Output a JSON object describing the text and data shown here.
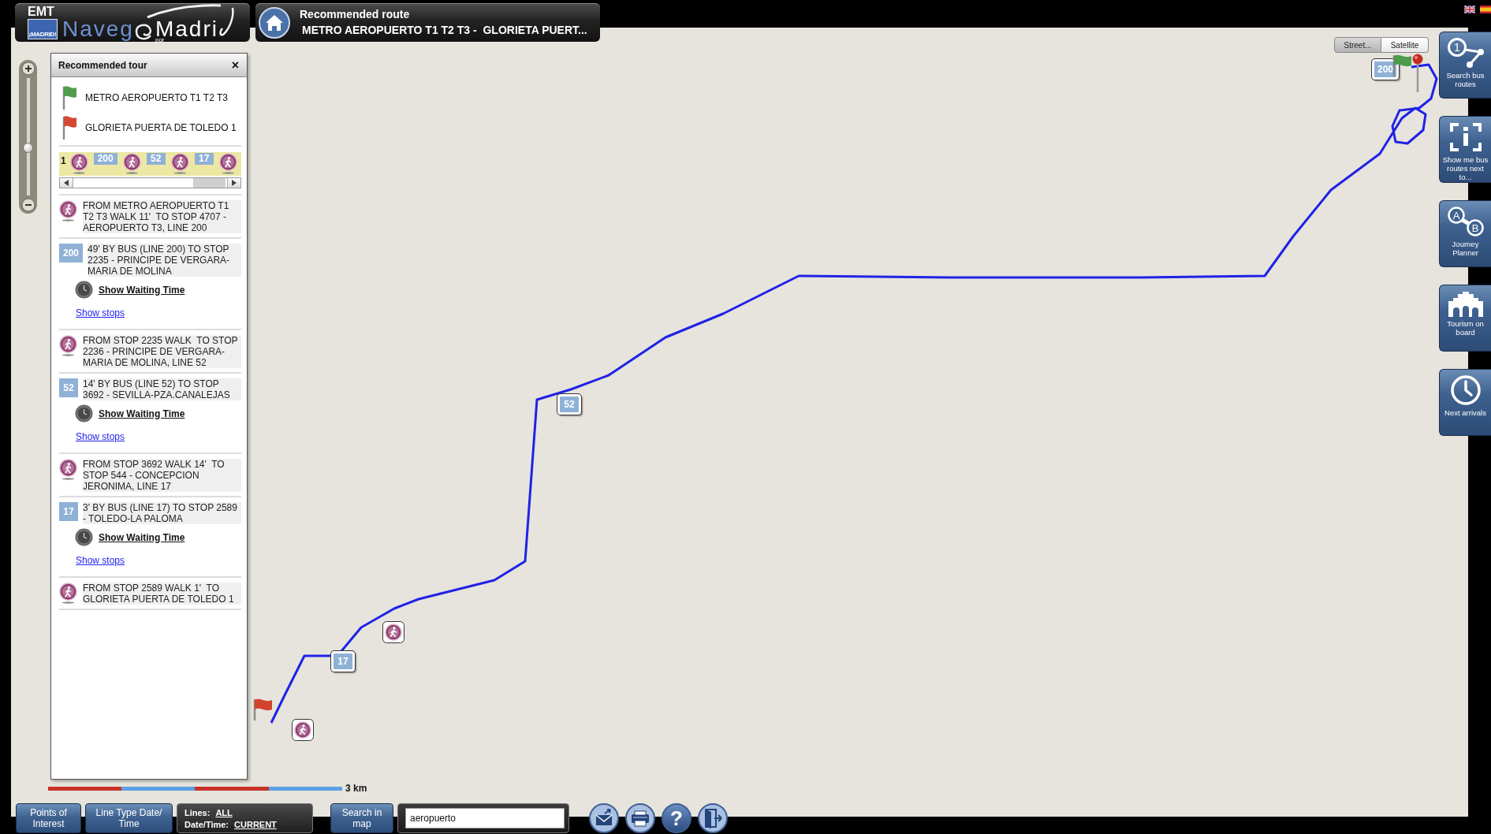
{
  "header": {
    "logo": {
      "org": "EMT",
      "city_badge": "¡MADRID!",
      "word_1": "Naveg",
      "word_2": "Madri",
      "small_word": "por"
    },
    "route_box": {
      "title": "Recommended route",
      "route": "METRO AEROPUERTO T1 T2 T3 -  GLORIETA PUERT..."
    }
  },
  "panel": {
    "title": "Recommended tour",
    "close": "×",
    "endpoints": [
      {
        "kind": "origin",
        "label": "METRO AEROPUERTO T1 T2 T3"
      },
      {
        "kind": "destination",
        "label": "GLORIETA PUERTA DE TOLEDO 1"
      }
    ],
    "legs": {
      "number": "1",
      "items": [
        {
          "kind": "walk"
        },
        {
          "kind": "bus",
          "line": "200"
        },
        {
          "kind": "walk"
        },
        {
          "kind": "bus",
          "line": "52"
        },
        {
          "kind": "walk"
        },
        {
          "kind": "bus",
          "line": "17"
        },
        {
          "kind": "walk"
        }
      ]
    },
    "steps": [
      {
        "kind": "walk",
        "text": "FROM METRO AEROPUERTO T1 T2 T3 WALK 11'  TO STOP 4707 - AEROPUERTO T3, LINE 200"
      },
      {
        "kind": "bus",
        "line": "200",
        "text": "49' BY BUS (LINE 200) TO STOP 2235 - PRINCIPE DE VERGARA-MARIA DE MOLINA",
        "waiting_link": "Show Waiting Time",
        "stops_link": "Show stops"
      },
      {
        "kind": "walk",
        "text": "FROM STOP 2235 WALK  TO STOP 2236 - PRINCIPE DE VERGARA-MARIA DE MOLINA, LINE 52"
      },
      {
        "kind": "bus",
        "line": "52",
        "text": "14' BY BUS (LINE 52) TO STOP 3692 - SEVILLA-PZA.CANALEJAS",
        "waiting_link": "Show Waiting Time",
        "stops_link": "Show stops"
      },
      {
        "kind": "walk",
        "text": "FROM STOP 3692 WALK 14'  TO STOP 544 - CONCEPCION JERONIMA, LINE 17"
      },
      {
        "kind": "bus",
        "line": "17",
        "text": "3' BY BUS (LINE 17) TO STOP 2589 - TOLEDO-LA PALOMA",
        "waiting_link": "Show Waiting Time",
        "stops_link": "Show stops"
      },
      {
        "kind": "walk",
        "text": "FROM STOP 2589 WALK 1'  TO GLORIETA PUERTA DE TOLEDO 1"
      }
    ]
  },
  "map": {
    "view_toggle": [
      {
        "label": "Street...",
        "selected": true
      },
      {
        "label": "Satellite",
        "selected": false
      }
    ],
    "zoom": {
      "level": 0.4
    },
    "markers": [
      {
        "kind": "bus",
        "label": "200"
      },
      {
        "kind": "bus",
        "label": "52"
      },
      {
        "kind": "bus",
        "label": "17"
      },
      {
        "kind": "walk"
      },
      {
        "kind": "walk"
      },
      {
        "kind": "start"
      },
      {
        "kind": "end"
      }
    ],
    "scale": {
      "label": "3 km"
    }
  },
  "side_tools": [
    {
      "kind": "routes",
      "label": "Search bus routes",
      "number": "1"
    },
    {
      "kind": "nearby",
      "label": "Show me bus routes next to..."
    },
    {
      "kind": "planner",
      "label": "Journey Planner",
      "points": [
        "A",
        "B"
      ]
    },
    {
      "kind": "tourism",
      "label": "Tourism on board"
    },
    {
      "kind": "arrivals",
      "label": "Next arrivals"
    }
  ],
  "bottom_bar": {
    "buttons": [
      {
        "label": "Points of Interest"
      },
      {
        "label": "Line Type Date/\nTime"
      }
    ],
    "filters": [
      {
        "label": "Lines:",
        "value": "ALL"
      },
      {
        "label": "Date/Time:",
        "value": "CURRENT"
      }
    ],
    "search_button": "Search in map",
    "search_field": {
      "value": "aeropuerto"
    },
    "icon_buttons": [
      {
        "kind": "mail"
      },
      {
        "kind": "print"
      },
      {
        "kind": "help",
        "glyph": "?"
      },
      {
        "kind": "exit"
      }
    ]
  }
}
